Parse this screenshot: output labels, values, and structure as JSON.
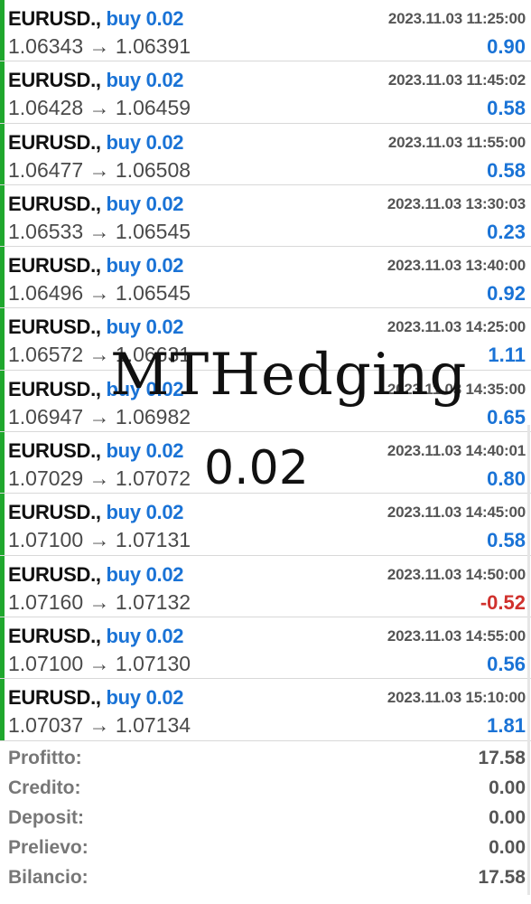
{
  "colors": {
    "accent_blue": "#1a73d6",
    "loss_red": "#d0312d",
    "buy_bar_green": "#1fa72d"
  },
  "trades": [
    {
      "symbol": "EURUSD.",
      "type": "buy 0.02",
      "time": "2023.11.03 11:25:00",
      "open": "1.06343",
      "close": "1.06391",
      "profit": "0.90"
    },
    {
      "symbol": "EURUSD.",
      "type": "buy 0.02",
      "time": "2023.11.03 11:45:02",
      "open": "1.06428",
      "close": "1.06459",
      "profit": "0.58"
    },
    {
      "symbol": "EURUSD.",
      "type": "buy 0.02",
      "time": "2023.11.03 11:55:00",
      "open": "1.06477",
      "close": "1.06508",
      "profit": "0.58"
    },
    {
      "symbol": "EURUSD.",
      "type": "buy 0.02",
      "time": "2023.11.03 13:30:03",
      "open": "1.06533",
      "close": "1.06545",
      "profit": "0.23"
    },
    {
      "symbol": "EURUSD.",
      "type": "buy 0.02",
      "time": "2023.11.03 13:40:00",
      "open": "1.06496",
      "close": "1.06545",
      "profit": "0.92"
    },
    {
      "symbol": "EURUSD.",
      "type": "buy 0.02",
      "time": "2023.11.03 14:25:00",
      "open": "1.06572",
      "close": "1.06631",
      "profit": "1.11"
    },
    {
      "symbol": "EURUSD.",
      "type": "buy 0.02",
      "time": "2023.11.03 14:35:00",
      "open": "1.06947",
      "close": "1.06982",
      "profit": "0.65"
    },
    {
      "symbol": "EURUSD.",
      "type": "buy 0.02",
      "time": "2023.11.03 14:40:01",
      "open": "1.07029",
      "close": "1.07072",
      "profit": "0.80"
    },
    {
      "symbol": "EURUSD.",
      "type": "buy 0.02",
      "time": "2023.11.03 14:45:00",
      "open": "1.07100",
      "close": "1.07131",
      "profit": "0.58"
    },
    {
      "symbol": "EURUSD.",
      "type": "buy 0.02",
      "time": "2023.11.03 14:50:00",
      "open": "1.07160",
      "close": "1.07132",
      "profit": "-0.52"
    },
    {
      "symbol": "EURUSD.",
      "type": "buy 0.02",
      "time": "2023.11.03 14:55:00",
      "open": "1.07100",
      "close": "1.07130",
      "profit": "0.56"
    },
    {
      "symbol": "EURUSD.",
      "type": "buy 0.02",
      "time": "2023.11.03 15:10:00",
      "open": "1.07037",
      "close": "1.07134",
      "profit": "1.81"
    }
  ],
  "price_arrow": "→",
  "summary": [
    {
      "label": "Profitto:",
      "value": "17.58"
    },
    {
      "label": "Credito:",
      "value": "0.00"
    },
    {
      "label": "Deposit:",
      "value": "0.00"
    },
    {
      "label": "Prelievo:",
      "value": "0.00"
    },
    {
      "label": "Bilancio:",
      "value": "17.58"
    }
  ],
  "watermark": {
    "title": "MTHedging",
    "subtitle": "0.02"
  }
}
